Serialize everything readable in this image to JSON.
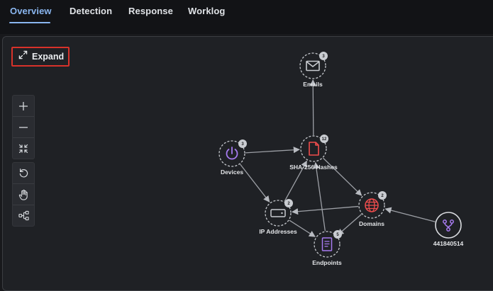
{
  "tabs": [
    {
      "label": "Overview",
      "active": true
    },
    {
      "label": "Detection",
      "active": false
    },
    {
      "label": "Response",
      "active": false
    },
    {
      "label": "Worklog",
      "active": false
    }
  ],
  "expand_label": "Expand",
  "zoom_controls": [
    "zoom-in",
    "zoom-out",
    "fit-to-screen",
    "reset",
    "pan",
    "layout"
  ],
  "graph": {
    "nodes": [
      {
        "id": "emails",
        "label": "Emails",
        "count": "3",
        "icon": "envelope-icon",
        "color": "#c9ccd1"
      },
      {
        "id": "hashes",
        "label": "SHA-256 Hashes",
        "count": "12",
        "icon": "file-icon",
        "color": "#f04d4d"
      },
      {
        "id": "devices",
        "label": "Devices",
        "count": "3",
        "icon": "power-icon",
        "color": "#a77bf0"
      },
      {
        "id": "ip",
        "label": "IP Addresses",
        "count": "2",
        "icon": "server-icon",
        "color": "#c9ccd1"
      },
      {
        "id": "domains",
        "label": "Domains",
        "count": "2",
        "icon": "globe-icon",
        "color": "#f04d4d"
      },
      {
        "id": "endpoints",
        "label": "Endpoints",
        "count": "5",
        "icon": "document-icon",
        "color": "#a77bf0"
      },
      {
        "id": "hub",
        "label": "441840514",
        "count": "",
        "icon": "branch-icon",
        "color": "#a77bf0"
      }
    ],
    "edges": [
      {
        "from": "hashes",
        "to": "emails"
      },
      {
        "from": "devices",
        "to": "hashes"
      },
      {
        "from": "devices",
        "to": "ip"
      },
      {
        "from": "ip",
        "to": "hashes"
      },
      {
        "from": "hashes",
        "to": "domains"
      },
      {
        "from": "domains",
        "to": "ip"
      },
      {
        "from": "ip",
        "to": "endpoints"
      },
      {
        "from": "endpoints",
        "to": "hashes"
      },
      {
        "from": "domains",
        "to": "endpoints"
      },
      {
        "from": "hub",
        "to": "domains"
      }
    ]
  },
  "colors": {
    "accent": "#8ab6ef",
    "highlight": "#d8322a",
    "red": "#f04d4d",
    "purple": "#a77bf0"
  }
}
